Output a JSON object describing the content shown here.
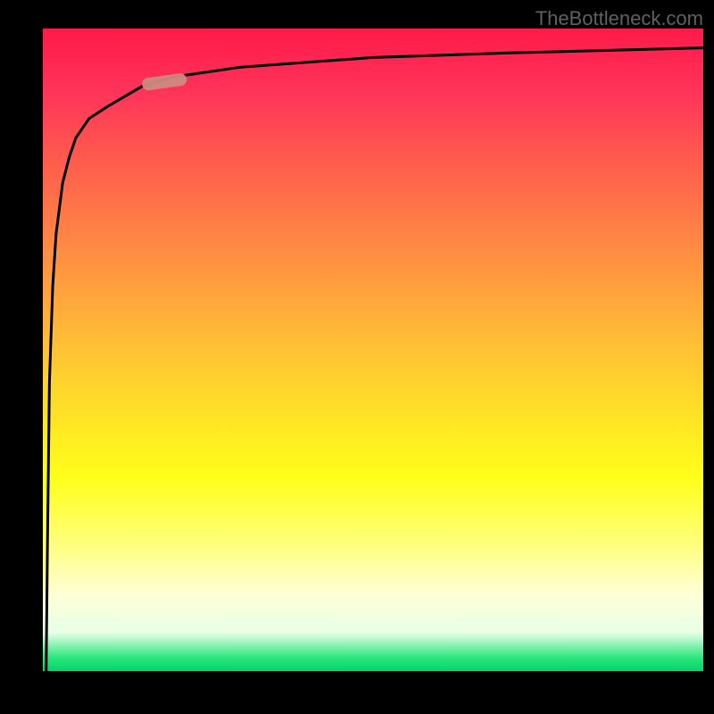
{
  "watermark": "TheBottleneck.com",
  "colors": {
    "gradient_top": "#ff1a48",
    "gradient_mid": "#ffff1a",
    "gradient_bottom": "#00d66a",
    "curve": "#000000",
    "marker": "#cf8a82"
  },
  "chart_data": {
    "type": "line",
    "title": "",
    "xlabel": "",
    "ylabel": "",
    "xlim": [
      0,
      100
    ],
    "ylim": [
      0,
      100
    ],
    "series": [
      {
        "name": "curve",
        "x": [
          0.5,
          0.7,
          1,
          1.5,
          2,
          3,
          4,
          5,
          7,
          10,
          15,
          20,
          30,
          50,
          70,
          100
        ],
        "y": [
          0,
          20,
          45,
          60,
          68,
          76,
          80,
          83,
          86,
          88,
          91,
          92.5,
          94,
          95.5,
          96.2,
          97
        ]
      }
    ],
    "annotations": [
      {
        "type": "marker",
        "name": "highlight",
        "x_range": [
          15,
          21
        ],
        "y_range": [
          90.5,
          92.8
        ],
        "color": "#cf8a82"
      }
    ],
    "background_gradient": {
      "direction": "vertical",
      "stops": [
        {
          "pos": 0.0,
          "color": "#ff1a48"
        },
        {
          "pos": 0.5,
          "color": "#ffc234"
        },
        {
          "pos": 0.75,
          "color": "#ffff1a"
        },
        {
          "pos": 0.95,
          "color": "#ffffff"
        },
        {
          "pos": 1.0,
          "color": "#00d66a"
        }
      ]
    }
  }
}
